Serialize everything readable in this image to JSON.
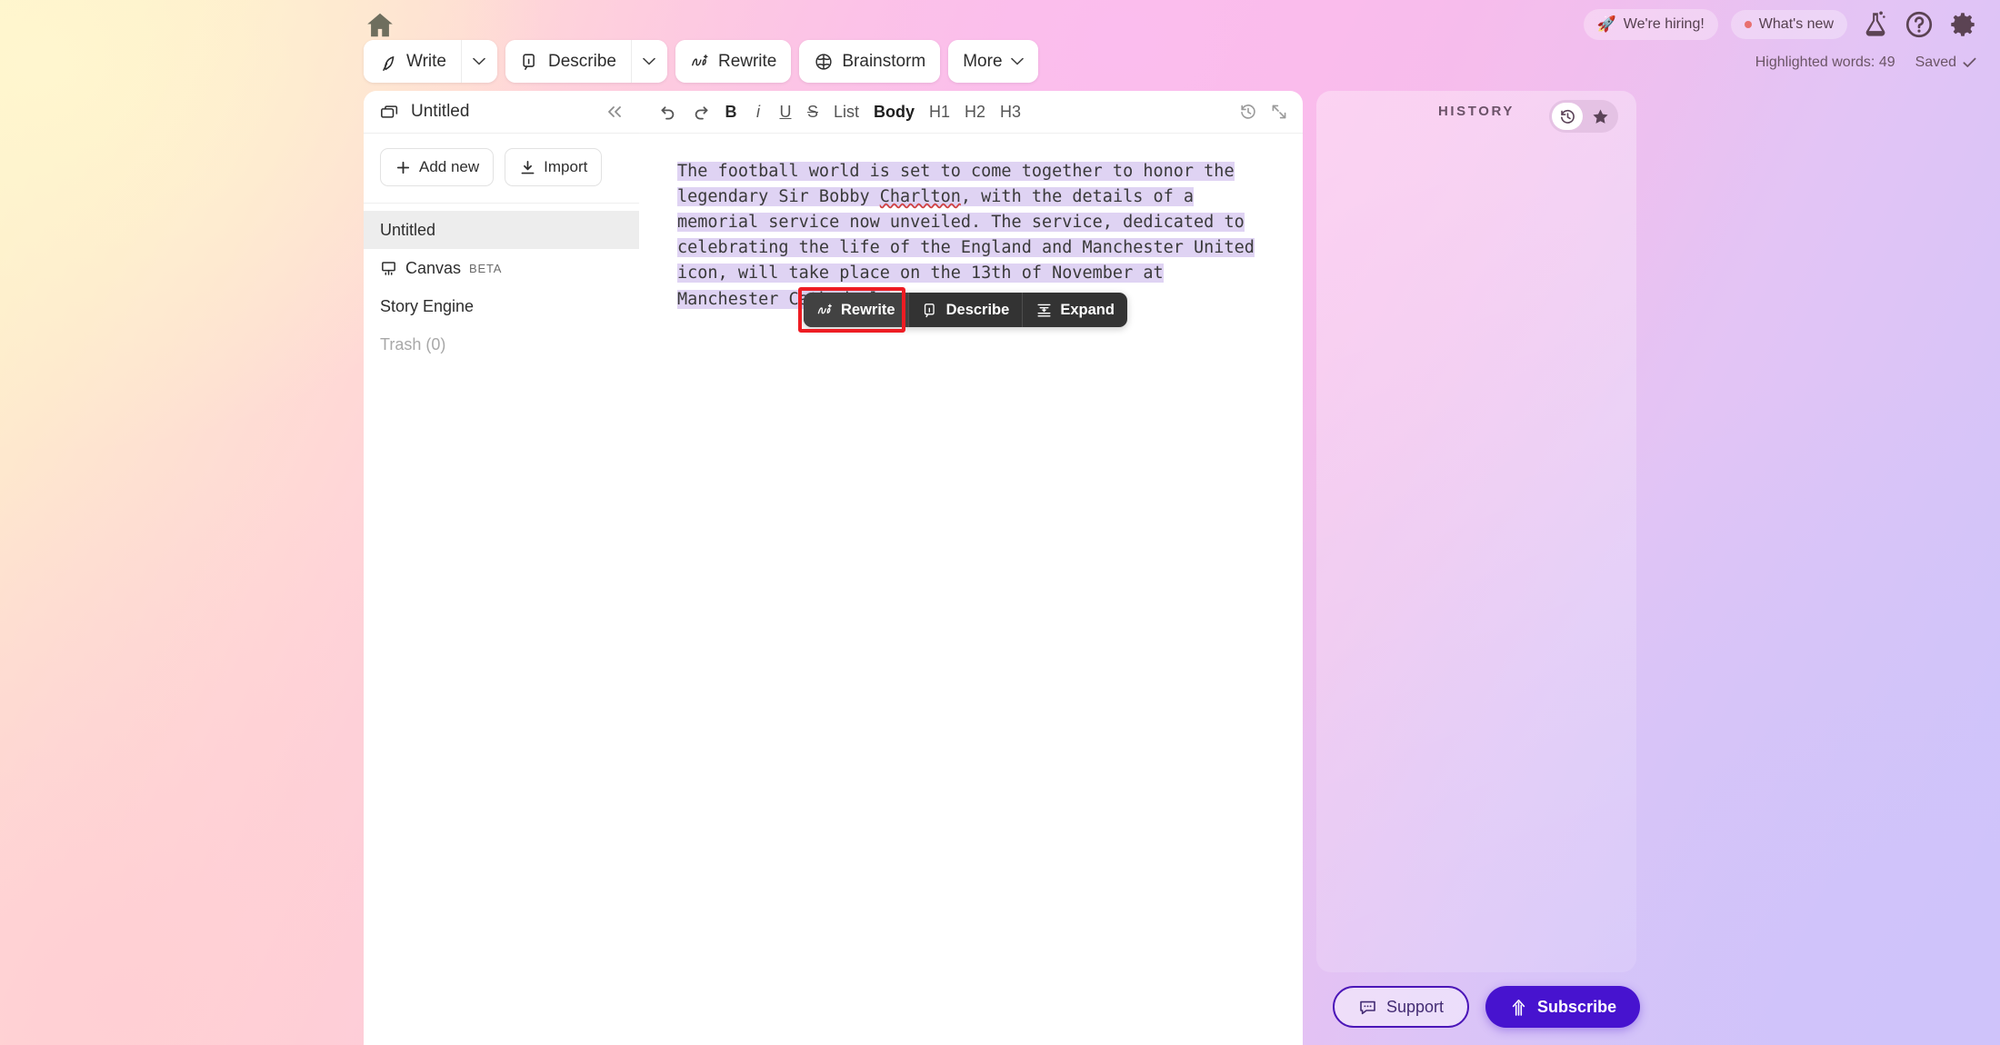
{
  "app": {
    "home_icon": "home-icon"
  },
  "toolbar": {
    "groups": [
      {
        "label": "Write",
        "icon": "quill-pen-icon",
        "has_caret": true
      },
      {
        "label": "Describe",
        "icon": "describe-card-icon",
        "has_caret": true
      },
      {
        "label": "Rewrite",
        "icon": "ai-sparkle-icon",
        "has_caret": false
      },
      {
        "label": "Brainstorm",
        "icon": "brain-icon",
        "has_caret": false
      },
      {
        "label": "More",
        "icon": "",
        "has_caret": true
      }
    ]
  },
  "top_right": {
    "hiring_label": "We're hiring!",
    "hiring_icon": "rocket-icon",
    "whats_new_label": "What's new",
    "whats_new_dot_color": "#E8706F",
    "icons": [
      "lab-flask-icon",
      "help-circle-icon",
      "gear-icon"
    ],
    "highlighted_words_label": "Highlighted words: 49",
    "saved_label": "Saved"
  },
  "sidebar": {
    "title": "Untitled",
    "title_icon": "folder-icon",
    "collapse_icon": "chevrons-left-icon",
    "add_new_label": "Add new",
    "import_label": "Import",
    "items": [
      {
        "label": "Untitled",
        "icon": "",
        "badge": "",
        "selected": true,
        "muted": false
      },
      {
        "label": "Canvas",
        "icon": "easel-icon",
        "badge": "BETA",
        "selected": false,
        "muted": false
      },
      {
        "label": "Story Engine",
        "icon": "",
        "badge": "",
        "selected": false,
        "muted": false
      },
      {
        "label": "Trash (0)",
        "icon": "",
        "badge": "",
        "selected": false,
        "muted": true
      }
    ]
  },
  "editor": {
    "toolbar": {
      "undo_icon": "undo-icon",
      "redo_icon": "redo-icon",
      "bold_label": "B",
      "italic_label": "i",
      "underline_label": "U",
      "strike_label": "S",
      "list_label": "List",
      "body_label": "Body",
      "h1_label": "H1",
      "h2_label": "H2",
      "h3_label": "H3",
      "history_icon": "clock-history-icon",
      "expand_icon": "expand-diagonal-icon"
    },
    "document": {
      "text_before": "The football world is set to come together to honor the legendary Sir Bobby ",
      "misspelled_word": "Charlton",
      "text_after": ", with the details of a memorial service now unveiled. The service, dedicated to celebrating the life of the England and Manchester United icon, will take place on the 13th of November at Manchester Cathedral.",
      "selection_color": "#DFD3F3"
    }
  },
  "floating_toolbar": {
    "buttons": [
      {
        "label": "Rewrite",
        "icon": "ai-sparkle-icon",
        "hovered": true,
        "focused": true
      },
      {
        "label": "Describe",
        "icon": "describe-card-icon",
        "hovered": false,
        "focused": false
      },
      {
        "label": "Expand",
        "icon": "expand-lines-icon",
        "hovered": false,
        "focused": false
      }
    ],
    "focus_ring_color": "#EE1C23"
  },
  "history_panel": {
    "title": "HISTORY",
    "toggle": [
      {
        "icon": "clock-history-icon",
        "active": true
      },
      {
        "icon": "star-icon",
        "active": false
      }
    ]
  },
  "bottom_actions": {
    "support_label": "Support",
    "support_icon": "chat-bubble-icon",
    "subscribe_label": "Subscribe",
    "subscribe_icon": "arrow-up-icon",
    "accent_color": "#4713CF"
  }
}
